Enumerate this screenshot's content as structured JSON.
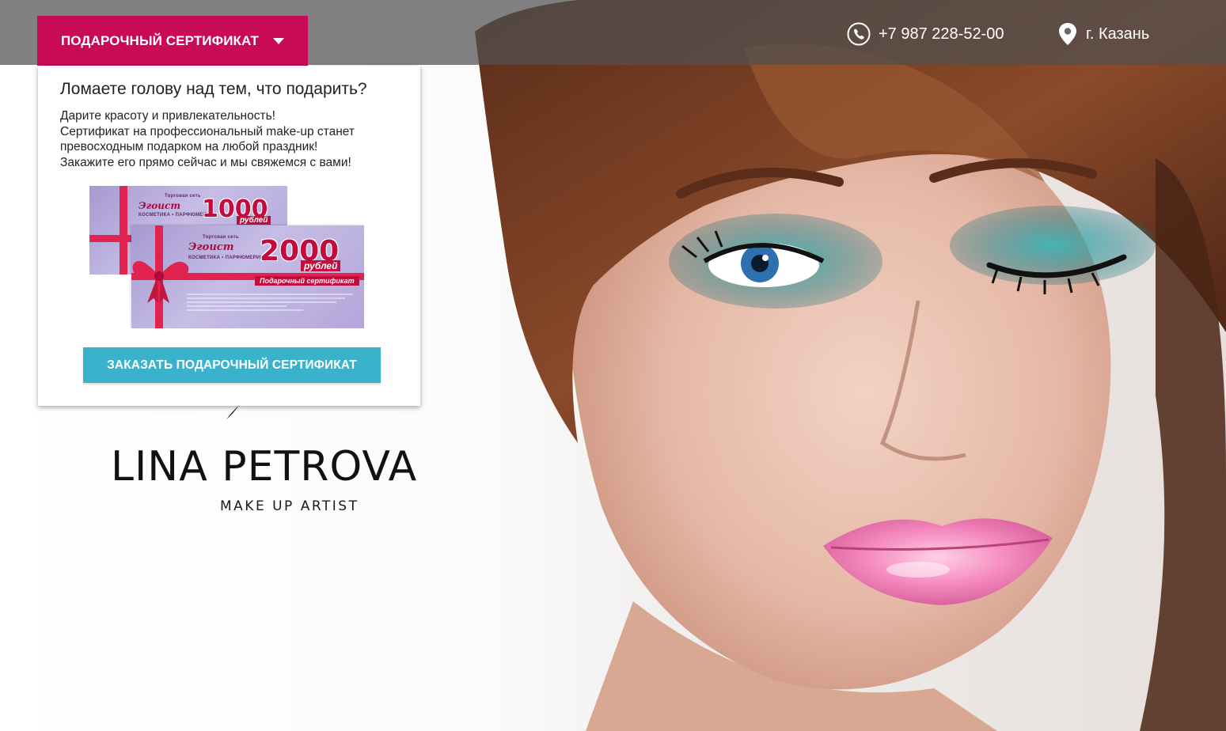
{
  "header": {
    "gift_button_label": "ПОДАРОЧНЫЙ СЕРТИФИКАТ",
    "phone": "+7 987 228-52-00",
    "city": "г. Казань"
  },
  "gift_panel": {
    "title": "Ломаете голову над тем, что подарить?",
    "text_lines": [
      "Дарите красоту и привлекательность!",
      "Сертификат на профессиональный make-up станет",
      "превосходным подарком на любой праздник!",
      "Закажите его прямо сейчас и мы свяжемся с вами!"
    ],
    "certificates": [
      {
        "brand_top": "Торговая сеть",
        "brand": "Эгоист",
        "brand_sub": "КОСМЕТИКА • ПАРФЮМЕРИЯ",
        "amount": "1000",
        "currency": "рублей"
      },
      {
        "brand_top": "Торговая сеть",
        "brand": "Эгоист",
        "brand_sub": "КОСМЕТИКА • ПАРФЮМЕРИЯ",
        "amount": "2000",
        "currency": "рублей",
        "label": "Подарочный сертификат"
      }
    ],
    "order_button_label": "ЗАКАЗАТЬ ПОДАРОЧНЫЙ СЕРТИФИКАТ"
  },
  "brand": {
    "name": "LINA PETROVA",
    "tagline": "MAKE UP ARTIST"
  },
  "colors": {
    "accent_magenta": "#c80a57",
    "button_teal": "#3bb2cb",
    "topbar": "#505050"
  }
}
